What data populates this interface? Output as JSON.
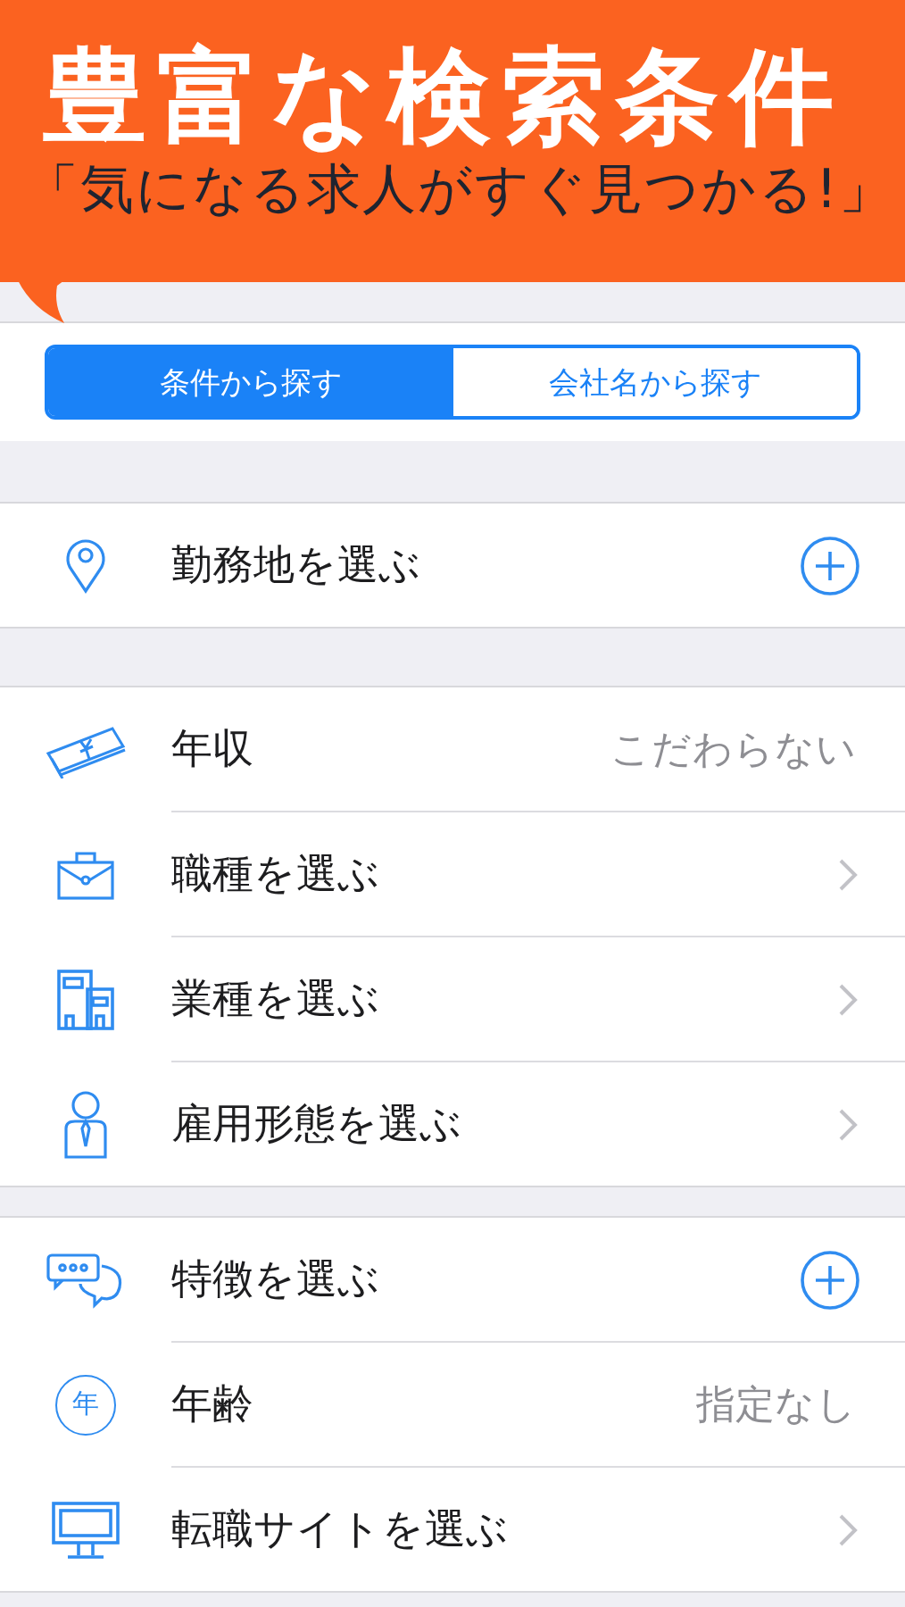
{
  "banner": {
    "title": "豊富な検索条件",
    "subtitle": "「気になる求人がすぐ見つかる!」"
  },
  "tabs": [
    {
      "label": "条件から探す",
      "selected": true
    },
    {
      "label": "会社名から探す",
      "selected": false
    }
  ],
  "groups": [
    {
      "rows": [
        {
          "label": "勤務地を選ぶ",
          "kind": "add"
        }
      ]
    },
    {
      "rows": [
        {
          "label": "年収",
          "kind": "value",
          "value": "こだわらない"
        },
        {
          "label": "職種を選ぶ",
          "kind": "link"
        },
        {
          "label": "業種を選ぶ",
          "kind": "link"
        },
        {
          "label": "雇用形態を選ぶ",
          "kind": "link"
        }
      ]
    },
    {
      "rows": [
        {
          "label": "特徴を選ぶ",
          "kind": "add"
        },
        {
          "icon_text": "年",
          "label": "年齢",
          "kind": "value",
          "value": "指定なし"
        },
        {
          "label": "転職サイトを選ぶ",
          "kind": "link"
        }
      ]
    }
  ]
}
